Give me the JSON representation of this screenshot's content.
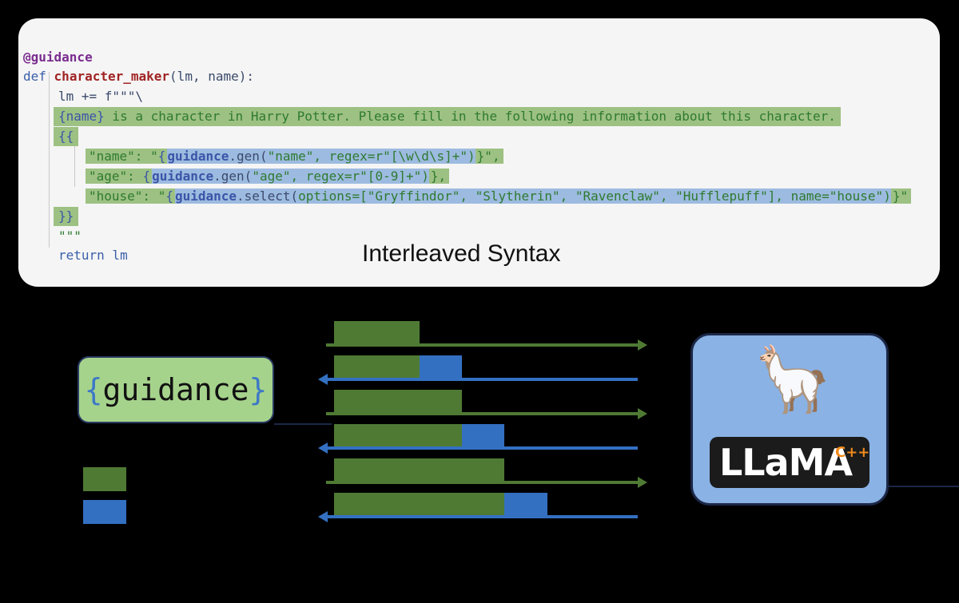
{
  "code": {
    "decorator": "@guidance",
    "def_kw": "def",
    "func_name": "character_maker",
    "params": "(lm, name):",
    "line3": "lm += f\"\"\"\\",
    "line4_placeholder": "{name}",
    "line4_text": " is a character in Harry Potter. Please fill in the following information about this character.",
    "line5": "{{",
    "name_key": "\"name\": \"",
    "name_open": "{",
    "name_mod": "guidance",
    "name_call": ".gen(",
    "name_args": "\"name\", regex=r\"[\\w\\d\\s]+\")",
    "name_close": "}\",",
    "age_key": "\"age\": ",
    "age_open": "{",
    "age_mod": "guidance",
    "age_call": ".gen(",
    "age_args": "\"age\", regex=r\"[0-9]+\")",
    "age_close": "},",
    "house_key": "\"house\": \"",
    "house_open": "{",
    "house_mod": "guidance",
    "house_call": ".select(",
    "house_args": "options=[\"Gryffindor\", \"Slytherin\", \"Ravenclaw\", \"Hufflepuff\"], name=\"house\")",
    "house_close": "}\"",
    "line9": "}}",
    "line10": "\"\"\"",
    "return_kw": "return",
    "return_val": " lm"
  },
  "panel_label": "Interleaved Syntax",
  "guidance_logo": {
    "open": "{",
    "word": "guidance",
    "close": "}"
  },
  "llama_logo": {
    "text": "LLaMA",
    "suffix": "C++",
    "emoji": "🦙"
  },
  "colors": {
    "prompt_green": "#4f7a34",
    "generation_blue": "#3370c2",
    "panel_bg": "#f5f5f5",
    "guidance_box": "#a6d38c",
    "llama_box": "#8ab2e4"
  },
  "legend": [
    {
      "icon": "green-swatch",
      "color": "#4f7a34"
    },
    {
      "icon": "blue-swatch",
      "color": "#3370c2"
    }
  ],
  "exchange_rows": [
    {
      "prompt": 0.22,
      "generated": 0
    },
    {
      "prompt": 0.22,
      "generated": 0.11
    },
    {
      "prompt": 0.33,
      "generated": 0
    },
    {
      "prompt": 0.33,
      "generated": 0.11
    },
    {
      "prompt": 0.44,
      "generated": 0
    },
    {
      "prompt": 0.44,
      "generated": 0.11
    }
  ]
}
